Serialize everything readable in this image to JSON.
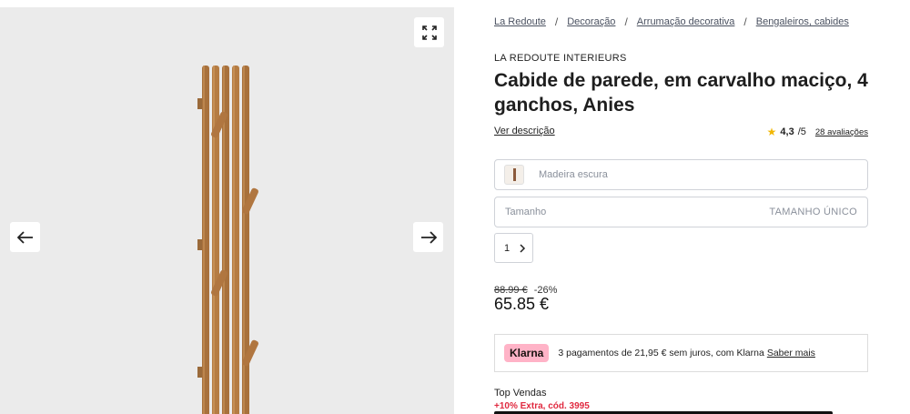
{
  "gallery": {
    "expand_icon": "expand-icon",
    "prev_icon": "arrow-left-icon",
    "next_icon": "arrow-right-icon"
  },
  "breadcrumb": [
    "La Redoute",
    "Decoração",
    "Arrumação decorativa",
    "Bengaleiros, cabides"
  ],
  "product": {
    "brand": "LA REDOUTE INTERIEURS",
    "title": "Cabide de parede, em carvalho maciço, 4 ganchos, Anies",
    "description_link": "Ver descrição",
    "rating": {
      "score": "4,3",
      "out_of": "/5",
      "reviews": "28 avaliações",
      "star_color": "#f2b705"
    }
  },
  "options": {
    "color_label": "Madeira escura",
    "swatch_color": "#8b5a3c",
    "size_label": "Tamanho",
    "size_value": "TAMANHO ÚNICO",
    "quantity": "1"
  },
  "pricing": {
    "old_price": "88.99 €",
    "discount": "-26%",
    "price": "65.85 €"
  },
  "klarna": {
    "logo": "Klarna",
    "text": "3 pagamentos de 21,95 € sem juros, com Klarna",
    "link": "Saber mais",
    "logo_bg": "#ffb3c7"
  },
  "promo": {
    "top_sales": "Top Vendas",
    "offer": "+10% Extra, cód. 3995",
    "offer_color": "#e0293f"
  }
}
